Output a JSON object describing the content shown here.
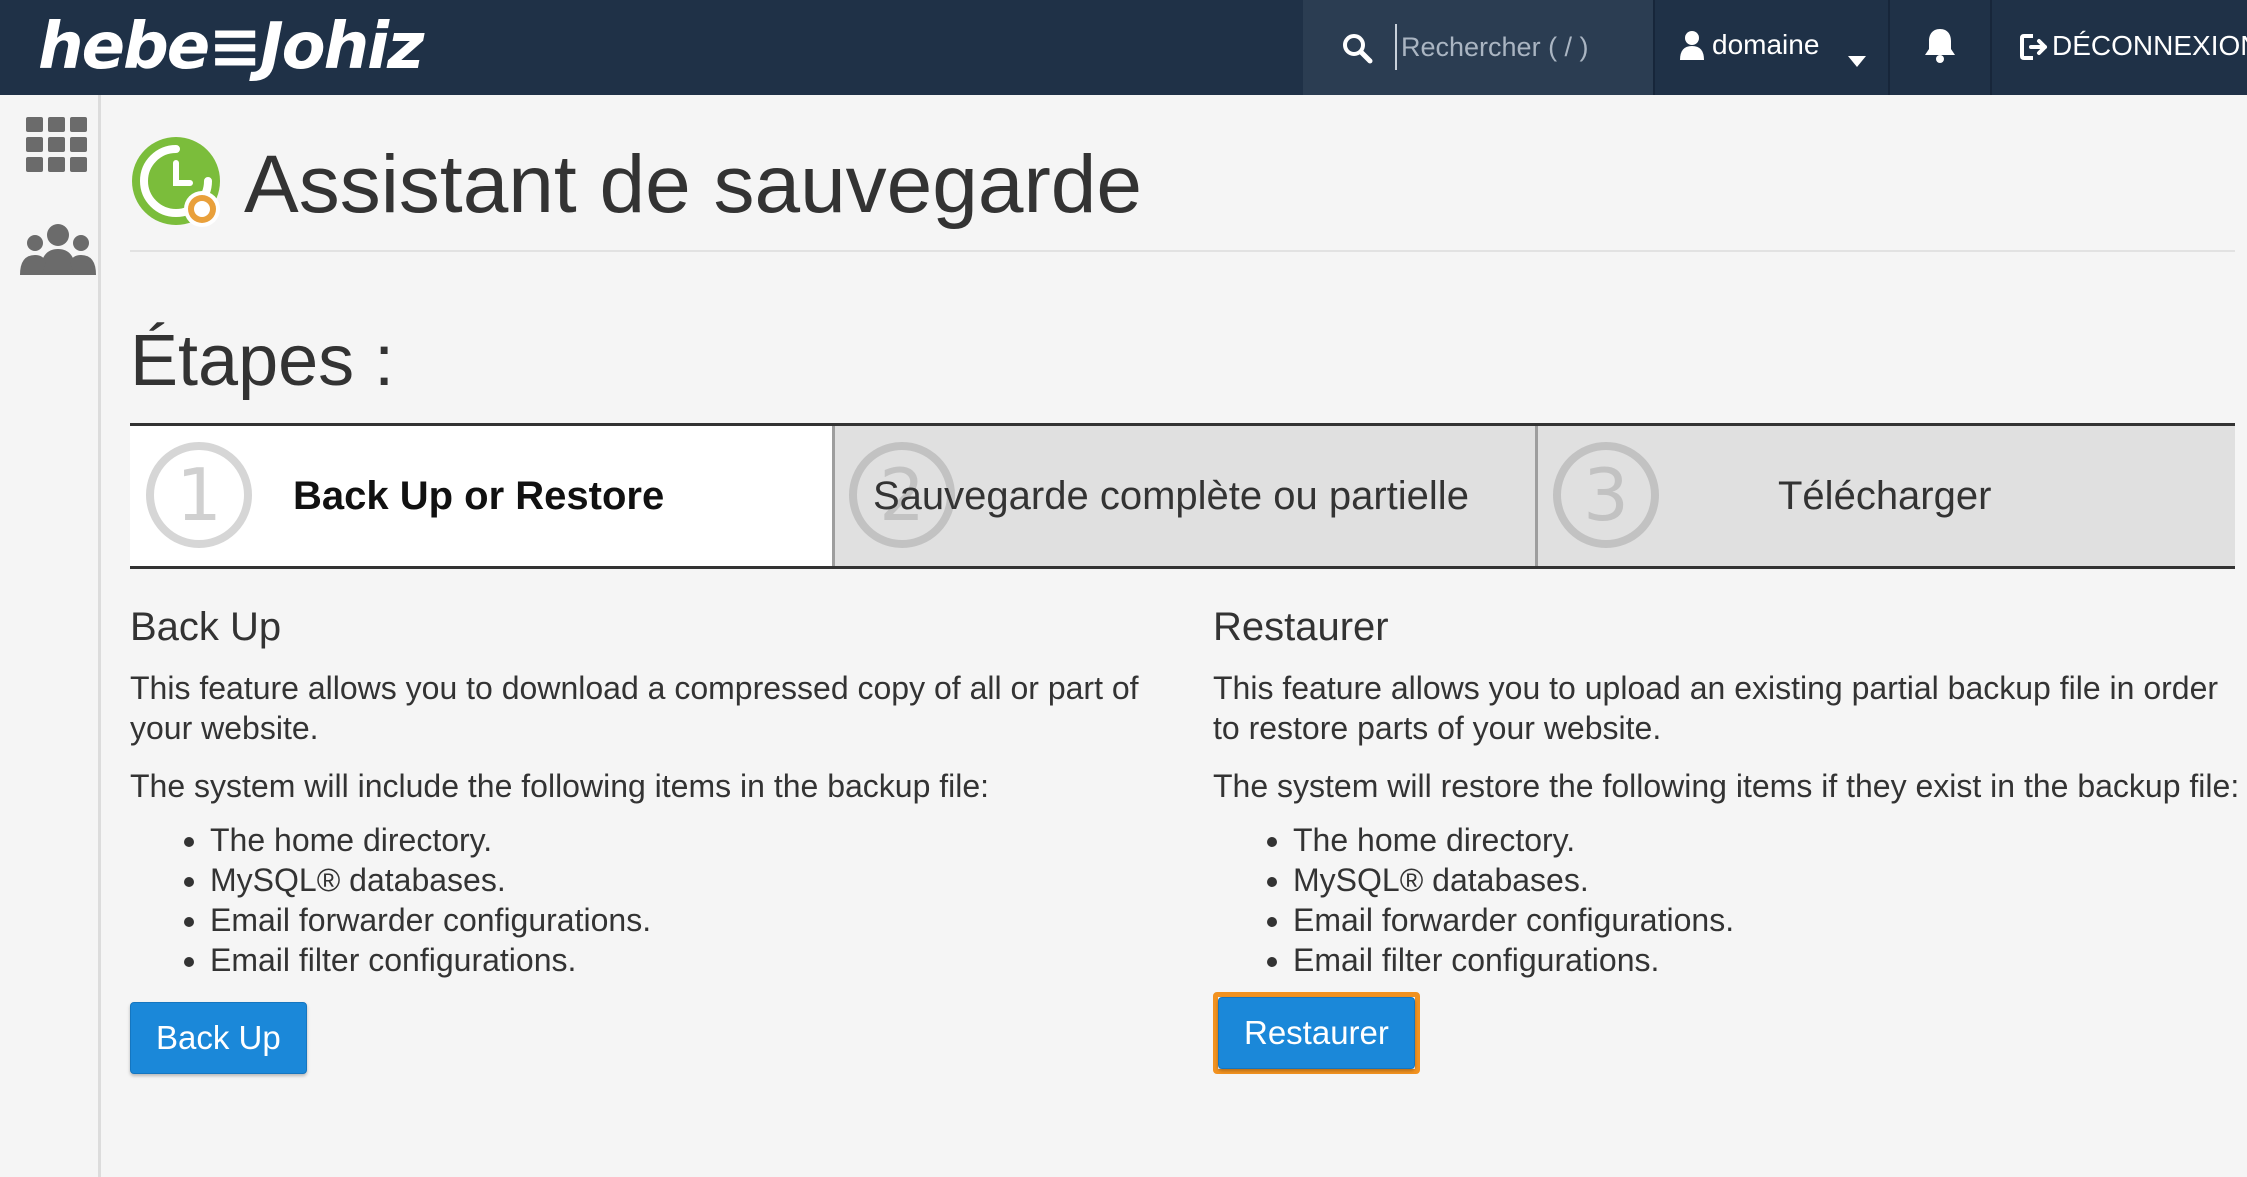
{
  "header": {
    "logo_text": "hebe≡Johiz",
    "search_placeholder": "Rechercher ( / )",
    "user_label": "domaine",
    "logout_label": "DÉCONNEXION"
  },
  "page": {
    "title": "Assistant de sauvegarde",
    "steps_heading": "Étapes :"
  },
  "steps": [
    {
      "number": "1",
      "label": "Back Up or Restore",
      "active": true
    },
    {
      "number": "2",
      "label": "Sauvegarde complète ou partielle",
      "active": false
    },
    {
      "number": "3",
      "label": "Télécharger",
      "active": false
    }
  ],
  "backup": {
    "heading": "Back Up",
    "description": "This feature allows you to download a compressed copy of all or part of your website.",
    "intro": "The system will include the following items in the backup file:",
    "items": [
      "The home directory.",
      "MySQL® databases.",
      "Email forwarder configurations.",
      "Email filter configurations."
    ],
    "button_label": "Back Up"
  },
  "restore": {
    "heading": "Restaurer",
    "description": "This feature allows you to upload an existing partial backup file in order to restore parts of your website.",
    "intro": "The system will restore the following items if they exist in the backup file:",
    "items": [
      "The home directory.",
      "MySQL® databases.",
      "Email forwarder configurations.",
      "Email filter configurations."
    ],
    "button_label": "Restaurer"
  },
  "icons": {
    "search": "search-icon",
    "user": "user-icon",
    "dropdown": "chevron-down-icon",
    "bell": "bell-icon",
    "logout": "logout-icon",
    "apps": "grid-icon",
    "users": "users-icon",
    "backup": "backup-wizard-icon"
  },
  "colors": {
    "header_bg": "#1f3147",
    "primary_button": "#1b88d9",
    "highlight": "#f29220"
  }
}
